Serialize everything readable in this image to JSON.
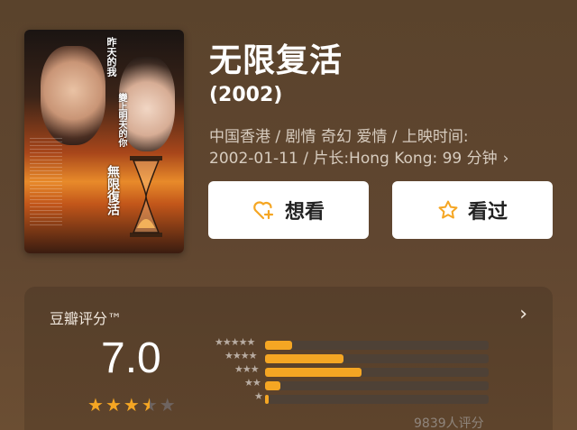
{
  "movie": {
    "title": "无限复活",
    "year": "(2002)",
    "meta_line1": "中国香港 / 剧情 奇幻 爱情 / 上映时间:",
    "meta_line2": "2002-01-11 / 片长:Hong Kong: 99 分钟",
    "poster_text": {
      "line1": "昨天的我",
      "line2": "變上明天的你",
      "title": "無限復活"
    }
  },
  "actions": {
    "want_label": "想看",
    "seen_label": "看过"
  },
  "rating": {
    "label": "豆瓣评分™",
    "score": "7.0",
    "stars_value": 3.5,
    "count_text": "9839人评分",
    "distribution": [
      {
        "stars": 5,
        "fraction": 0.12
      },
      {
        "stars": 4,
        "fraction": 0.35
      },
      {
        "stars": 3,
        "fraction": 0.43
      },
      {
        "stars": 2,
        "fraction": 0.07
      },
      {
        "stars": 1,
        "fraction": 0.015
      }
    ]
  },
  "colors": {
    "accent": "#f5a623",
    "background": "#5e452e"
  },
  "icons": {
    "want": "heart-plus-icon",
    "seen": "star-outline-icon",
    "more": "chevron-right-icon"
  }
}
